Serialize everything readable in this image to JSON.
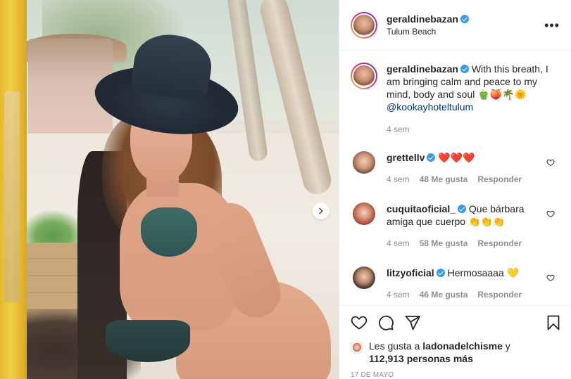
{
  "post": {
    "username": "geraldinebazan",
    "location": "Tulum Beach",
    "caption_text": "With this breath, I am bringing calm and peace to my mind, body and soul 🫑🍑🌴🌞",
    "caption_mention": "@kookayhoteltulum",
    "caption_time": "4 sem",
    "more_label": "•••"
  },
  "comments": [
    {
      "username": "grettellv",
      "text": "❤️❤️❤️",
      "time": "4 sem",
      "likes": "48 Me gusta",
      "reply": "Responder"
    },
    {
      "username": "cuquitaoficial_",
      "text": "Que bárbara amiga que cuerpo 👏👏👏",
      "time": "4 sem",
      "likes": "58 Me gusta",
      "reply": "Responder"
    },
    {
      "username": "litzyoficial",
      "text": "Hermosaaaa 💛",
      "time": "4 sem",
      "likes": "46 Me gusta",
      "reply": "Responder"
    }
  ],
  "likes": {
    "prefix": "Les gusta a",
    "user": "ladonadelchisme",
    "connector": "y",
    "count": "112,913 personas más"
  },
  "date": "17 de mayo",
  "icons": {
    "like": "heart-icon",
    "comment": "comment-icon",
    "share": "share-icon",
    "save": "bookmark-icon",
    "next": "chevron-right-icon",
    "verified": "verified-badge-icon"
  },
  "colors": {
    "verified": "#3897f0",
    "mention": "#00376b",
    "muted": "#8e8e8e",
    "text": "#262626"
  }
}
